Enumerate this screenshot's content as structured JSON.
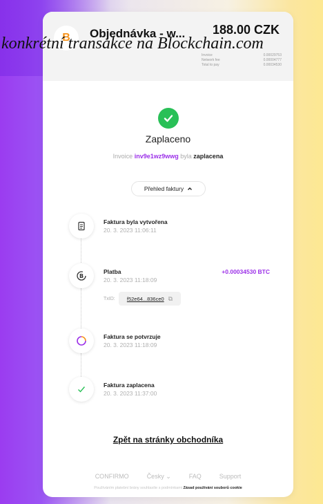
{
  "overlay_text": "konkrétní transakce na Blockchain.com",
  "header": {
    "logo": "B",
    "merchant": "Objednávka - w...",
    "price": "188.00 CZK",
    "fees": [
      {
        "label": "Invoice",
        "value": "0.00029753"
      },
      {
        "label": "Network fee",
        "value": "0.00004777"
      },
      {
        "label": "Total to pay",
        "value": "0.00034530"
      }
    ]
  },
  "status": {
    "title": "Zaplaceno",
    "invoice_prefix": "Invoice",
    "invoice_id": "inv9e1wz9wwg",
    "invoice_mid": "byla",
    "invoice_state": "zaplacena"
  },
  "overview_button": "Přehled faktury",
  "timeline": [
    {
      "title": "Faktura byla vytvořena",
      "date": "20. 3. 2023 11:06:11",
      "icon": "document-icon"
    },
    {
      "title": "Platba",
      "date": "20. 3. 2023 11:18:09",
      "icon": "bitcoin-cycle-icon",
      "amount": "+0.00034530 BTC",
      "txid_label": "TxID:",
      "txid": "f52e64...836ce0"
    },
    {
      "title": "Faktura se potvrzuje",
      "date": "20. 3. 2023 11:18:09",
      "icon": "spinner-icon"
    },
    {
      "title": "Faktura zaplacena",
      "date": "20. 3. 2023 11:37:00",
      "icon": "check-icon"
    }
  ],
  "back_link": "Zpět na stránky obchodníka",
  "footer": {
    "brand": "CONFIRMO",
    "language": "Česky",
    "faq": "FAQ",
    "support": "Support",
    "note_prefix": "Používáním platební brány souhlasíte s podmínkami",
    "note_link": "Zásad používání souborů cookie"
  },
  "colors": {
    "accent": "#9b2fe8",
    "success": "#29c057",
    "bitcoin": "#f7931a"
  }
}
